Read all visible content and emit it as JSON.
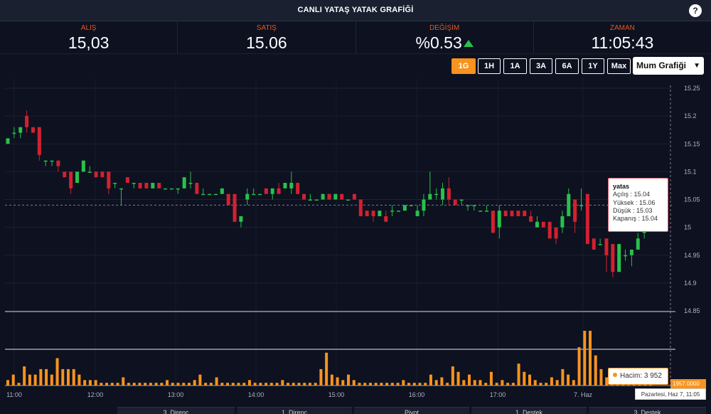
{
  "header": {
    "title": "CANLI YATAŞ YATAK GRAFİĞİ",
    "help_label": "?"
  },
  "stats": [
    {
      "label": "ALIŞ",
      "value": "15,03"
    },
    {
      "label": "SATIŞ",
      "value": "15.06"
    },
    {
      "label": "DEĞİŞİM",
      "value": "%0.53"
    },
    {
      "label": "ZAMAN",
      "value": "11:05:43"
    }
  ],
  "ranges": [
    "1G",
    "1H",
    "1A",
    "3A",
    "6A",
    "1Y",
    "Max"
  ],
  "active_range": "1G",
  "chart_type_select": {
    "value": "Mum Grafiği"
  },
  "colors": {
    "up": "#27c24c",
    "down": "#d3212f",
    "volume": "#f7931e",
    "accent": "#e8561c"
  },
  "chart_data": {
    "type": "candlestick",
    "price_axis_ticks": [
      "15.25",
      "15.2",
      "15.15",
      "15.1",
      "15.05",
      "15",
      "14.95",
      "14.9",
      "14.85"
    ],
    "ylim": [
      14.85,
      15.25
    ],
    "time_axis_ticks": [
      "11:00",
      "12:00",
      "13:00",
      "14:00",
      "15:00",
      "16:00",
      "17:00",
      "7. Haz"
    ],
    "candles": [
      [
        15.15,
        15.16,
        15.15,
        15.16
      ],
      [
        15.17,
        15.18,
        15.16,
        15.17
      ],
      [
        15.17,
        15.18,
        15.16,
        15.18
      ],
      [
        15.2,
        15.21,
        15.17,
        15.18
      ],
      [
        15.18,
        15.18,
        15.17,
        15.17
      ],
      [
        15.18,
        15.18,
        15.12,
        15.13
      ],
      [
        15.12,
        15.12,
        15.11,
        15.12
      ],
      [
        15.12,
        15.12,
        15.11,
        15.12
      ],
      [
        15.12,
        15.12,
        15.1,
        15.11
      ],
      [
        15.1,
        15.1,
        15.09,
        15.09
      ],
      [
        15.1,
        15.1,
        15.06,
        15.07
      ],
      [
        15.08,
        15.1,
        15.08,
        15.1
      ],
      [
        15.1,
        15.12,
        15.1,
        15.12
      ],
      [
        15.1,
        15.11,
        15.1,
        15.1
      ],
      [
        15.1,
        15.1,
        15.09,
        15.09
      ],
      [
        15.1,
        15.1,
        15.09,
        15.09
      ],
      [
        15.1,
        15.1,
        15.06,
        15.07
      ],
      [
        15.08,
        15.08,
        15.07,
        15.08
      ],
      [
        15.07,
        15.07,
        15.04,
        15.07
      ],
      [
        15.09,
        15.09,
        15.08,
        15.08
      ],
      [
        15.08,
        15.08,
        15.07,
        15.08
      ],
      [
        15.08,
        15.08,
        15.07,
        15.07
      ],
      [
        15.08,
        15.08,
        15.07,
        15.07
      ],
      [
        15.07,
        15.08,
        15.07,
        15.08
      ],
      [
        15.08,
        15.08,
        15.07,
        15.07
      ],
      [
        15.07,
        15.07,
        15.07,
        15.07
      ],
      [
        15.07,
        15.07,
        15.07,
        15.07
      ],
      [
        15.07,
        15.07,
        15.06,
        15.07
      ],
      [
        15.07,
        15.09,
        15.07,
        15.09
      ],
      [
        15.08,
        15.1,
        15.07,
        15.08
      ],
      [
        15.08,
        15.08,
        15.06,
        15.06
      ],
      [
        15.06,
        15.07,
        15.06,
        15.06
      ],
      [
        15.06,
        15.06,
        15.06,
        15.06
      ],
      [
        15.06,
        15.06,
        15.06,
        15.06
      ],
      [
        15.06,
        15.07,
        15.06,
        15.07
      ],
      [
        15.06,
        15.06,
        15.04,
        15.04
      ],
      [
        15.06,
        15.06,
        15.01,
        15.01
      ],
      [
        15.01,
        15.02,
        15.0,
        15.02
      ],
      [
        15.05,
        15.07,
        15.04,
        15.06
      ],
      [
        15.06,
        15.07,
        15.06,
        15.06
      ],
      [
        15.06,
        15.06,
        15.06,
        15.06
      ],
      [
        15.07,
        15.07,
        15.06,
        15.06
      ],
      [
        15.06,
        15.07,
        15.05,
        15.07
      ],
      [
        15.07,
        15.08,
        15.06,
        15.06
      ],
      [
        15.07,
        15.08,
        15.07,
        15.08
      ],
      [
        15.07,
        15.1,
        15.06,
        15.08
      ],
      [
        15.08,
        15.08,
        15.06,
        15.06
      ],
      [
        15.06,
        15.06,
        15.05,
        15.05
      ],
      [
        15.05,
        15.06,
        15.05,
        15.05
      ],
      [
        15.05,
        15.05,
        15.05,
        15.05
      ],
      [
        15.05,
        15.06,
        15.05,
        15.06
      ],
      [
        15.06,
        15.06,
        15.05,
        15.05
      ],
      [
        15.05,
        15.06,
        15.05,
        15.06
      ],
      [
        15.06,
        15.06,
        15.05,
        15.05
      ],
      [
        15.05,
        15.05,
        15.05,
        15.05
      ],
      [
        15.06,
        15.06,
        15.05,
        15.05
      ],
      [
        15.05,
        15.05,
        15.02,
        15.02
      ],
      [
        15.03,
        15.03,
        15.02,
        15.02
      ],
      [
        15.03,
        15.03,
        15.01,
        15.02
      ],
      [
        15.02,
        15.03,
        15.02,
        15.03
      ],
      [
        15.02,
        15.03,
        15.01,
        15.01
      ],
      [
        15.03,
        15.04,
        15.02,
        15.03
      ],
      [
        15.03,
        15.03,
        15.03,
        15.03
      ],
      [
        15.03,
        15.04,
        15.03,
        15.04
      ],
      [
        15.04,
        15.04,
        15.04,
        15.04
      ],
      [
        15.02,
        15.04,
        15.02,
        15.03
      ],
      [
        15.03,
        15.06,
        15.02,
        15.05
      ],
      [
        15.05,
        15.1,
        15.05,
        15.06
      ],
      [
        15.06,
        15.07,
        15.05,
        15.06
      ],
      [
        15.05,
        15.08,
        15.04,
        15.07
      ],
      [
        15.07,
        15.09,
        15.04,
        15.05
      ],
      [
        15.05,
        15.05,
        15.04,
        15.04
      ],
      [
        15.05,
        15.05,
        15.04,
        15.05
      ],
      [
        15.04,
        15.04,
        15.03,
        15.04
      ],
      [
        15.04,
        15.04,
        15.03,
        15.04
      ],
      [
        15.03,
        15.03,
        15.03,
        15.03
      ],
      [
        15.03,
        15.04,
        15.03,
        15.03
      ],
      [
        15.03,
        15.03,
        14.99,
        14.99
      ],
      [
        15.0,
        15.04,
        14.98,
        15.03
      ],
      [
        15.03,
        15.03,
        15.02,
        15.02
      ],
      [
        15.03,
        15.03,
        15.02,
        15.02
      ],
      [
        15.03,
        15.03,
        15.02,
        15.02
      ],
      [
        15.03,
        15.03,
        15.02,
        15.02
      ],
      [
        15.02,
        15.03,
        15.01,
        15.01
      ],
      [
        15.0,
        15.02,
        15.0,
        15.01
      ],
      [
        15.01,
        15.01,
        15.0,
        15.0
      ],
      [
        15.01,
        15.01,
        14.98,
        14.98
      ],
      [
        15.0,
        15.0,
        14.97,
        14.98
      ],
      [
        15.0,
        15.03,
        14.99,
        15.02
      ],
      [
        15.02,
        15.07,
        15.02,
        15.06
      ],
      [
        15.05,
        15.05,
        14.99,
        15.01
      ],
      [
        15.04,
        15.07,
        15.03,
        15.04
      ],
      [
        15.06,
        15.06,
        14.97,
        14.97
      ],
      [
        14.98,
        14.98,
        14.96,
        14.96
      ],
      [
        14.97,
        14.98,
        14.97,
        14.97
      ],
      [
        14.98,
        14.98,
        14.92,
        14.95
      ],
      [
        14.97,
        14.97,
        14.91,
        14.92
      ],
      [
        14.92,
        14.97,
        14.92,
        14.97
      ],
      [
        14.95,
        14.96,
        14.94,
        14.95
      ],
      [
        14.95,
        14.96,
        14.93,
        14.96
      ],
      [
        14.96,
        14.99,
        14.96,
        14.98
      ],
      [
        14.99,
        15.01,
        14.98,
        15.01
      ],
      [
        15.02,
        15.06,
        15.0,
        15.03
      ]
    ],
    "volume_axis_label": "1957.0000",
    "volumes": [
      0.1,
      0.2,
      0.05,
      0.35,
      0.2,
      0.2,
      0.3,
      0.3,
      0.2,
      0.5,
      0.3,
      0.3,
      0.3,
      0.2,
      0.1,
      0.1,
      0.1,
      0.05,
      0.05,
      0.05,
      0.05,
      0.15,
      0.05,
      0.05,
      0.05,
      0.05,
      0.05,
      0.05,
      0.05,
      0.1,
      0.05,
      0.05,
      0.05,
      0.05,
      0.1,
      0.2,
      0.05,
      0.05,
      0.15,
      0.05,
      0.05,
      0.05,
      0.05,
      0.05,
      0.1,
      0.05,
      0.05,
      0.05,
      0.05,
      0.05,
      0.1,
      0.05,
      0.05,
      0.05,
      0.05,
      0.05,
      0.05,
      0.3,
      0.6,
      0.2,
      0.15,
      0.1,
      0.2,
      0.1,
      0.05,
      0.05,
      0.05,
      0.05,
      0.05,
      0.05,
      0.05,
      0.05,
      0.1,
      0.05,
      0.05,
      0.05,
      0.05,
      0.2,
      0.1,
      0.15,
      0.05,
      0.35,
      0.25,
      0.1,
      0.2,
      0.1,
      0.1,
      0.05,
      0.25,
      0.05,
      0.1,
      0.05,
      0.05,
      0.4,
      0.25,
      0.2,
      0.1,
      0.05,
      0.05,
      0.15,
      0.1,
      0.3,
      0.2,
      0.1,
      0.7,
      1.0,
      1.0,
      0.55,
      0.3,
      0.15,
      0.2,
      0.1,
      0.05,
      0.1,
      0.2,
      0.2,
      0.1,
      0.2
    ]
  },
  "tooltip": {
    "name": "yatas",
    "open": "Açılış : 15.04",
    "high": "Yüksek : 15.06",
    "low": "Düşük : 15.03",
    "close": "Kapanış : 15.04"
  },
  "volume_tooltip": {
    "label": "Hacim: 3 952"
  },
  "volume_badge": "1957.0000",
  "date_badge": "Pazartesi, Haz 7, 11:05",
  "bottom_tabs": [
    "3. Direnç",
    "1. Direnç",
    "Pivot",
    "1. Destek",
    "3. Destek"
  ]
}
